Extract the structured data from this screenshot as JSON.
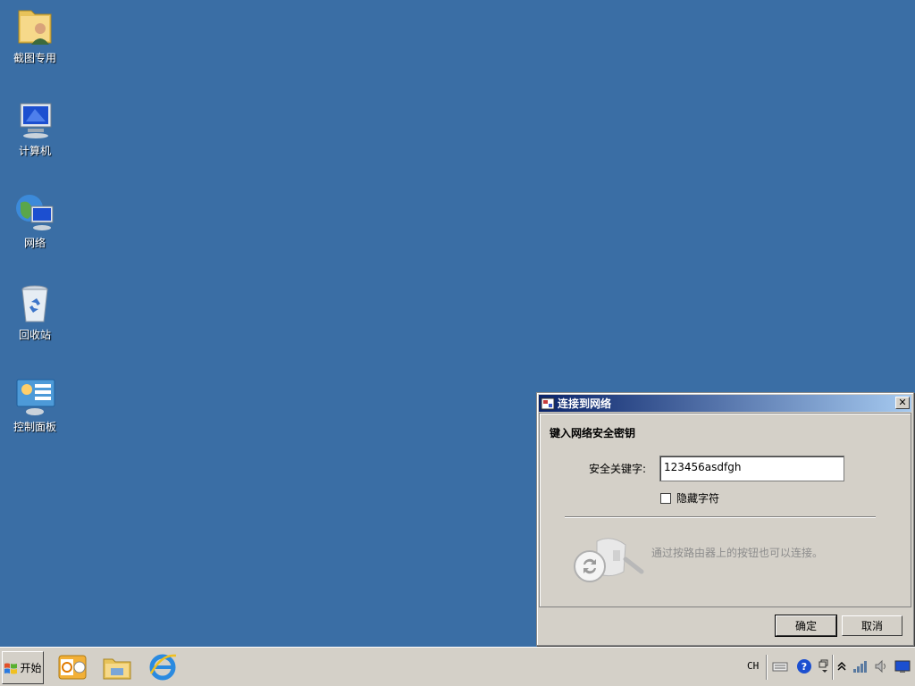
{
  "desktop": {
    "icons": [
      {
        "label": "截图专用",
        "icon": "user-folder-icon"
      },
      {
        "label": "计算机",
        "icon": "computer-icon"
      },
      {
        "label": "网络",
        "icon": "network-icon"
      },
      {
        "label": "回收站",
        "icon": "recycle-bin-icon"
      },
      {
        "label": "控制面板",
        "icon": "control-panel-icon"
      }
    ],
    "background_color": "#3a6ea5"
  },
  "dialog": {
    "title": "连接到网络",
    "heading": "键入网络安全密钥",
    "key_label": "安全关键字:",
    "key_value": "123456asdfgh",
    "hide_chars_label": "隐藏字符",
    "wps_hint": "通过按路由器上的按钮也可以连接。",
    "ok_label": "确定",
    "cancel_label": "取消"
  },
  "taskbar": {
    "start_label": "开始",
    "apps": [
      "outlook-icon",
      "explorer-icon",
      "ie-icon"
    ],
    "language": "CH",
    "tray_icons": [
      "keyboard-icon",
      "help-icon",
      "restore-icon",
      "show-hidden-icon",
      "network-tray-icon",
      "volume-icon",
      "show-desktop-icon"
    ]
  }
}
